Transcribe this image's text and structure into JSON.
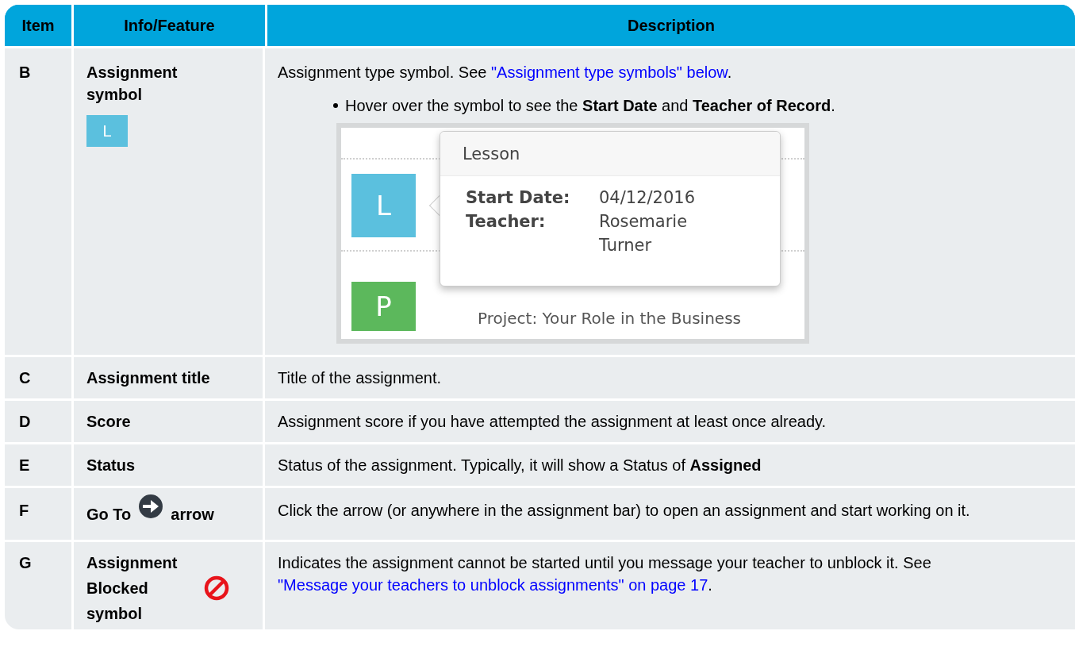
{
  "table": {
    "columns": [
      "Item",
      "Info/Feature",
      "Description"
    ],
    "rows": [
      {
        "item": "B",
        "feature": {
          "before": "Assignment symbol",
          "icon": {
            "kind": "tile",
            "letter": "L",
            "color": "#5bc0de"
          }
        },
        "description": [
          {
            "kind": "paragraph",
            "before": "Assignment type symbol. See ",
            "link": "\"Assignment type symbols\" below",
            "after": "."
          },
          {
            "kind": "bullet",
            "text": "Hover over the symbol to see the **Start Date** and **Teacher of Record**."
          },
          {
            "kind": "screenshot",
            "rows": [
              {
                "letter": "L",
                "color": "#5bc0de"
              },
              {
                "letter": "P",
                "color": "#5cb85c",
                "title": "Project: Your Role in the Business"
              }
            ],
            "tooltip": {
              "title": "Lesson",
              "fields": [
                {
                  "label": "Start Date:",
                  "value": "04/12/2016"
                },
                {
                  "label": "Teacher:",
                  "value": "Rosemarie Turner"
                }
              ]
            }
          }
        ]
      },
      {
        "item": "C",
        "feature": {
          "before": "Assignment title"
        },
        "description": [
          {
            "kind": "paragraph",
            "before": "Title of the assignment."
          }
        ]
      },
      {
        "item": "D",
        "feature": {
          "before": "Score"
        },
        "description": [
          {
            "kind": "paragraph",
            "before": "Assignment score if you have attempted the assignment at least once already."
          }
        ]
      },
      {
        "item": "E",
        "feature": {
          "before": "Status"
        },
        "description": [
          {
            "kind": "paragraph",
            "before": "Status of the assignment. Typically, it will show a Status of **Assigned**"
          }
        ]
      },
      {
        "item": "F",
        "feature": {
          "before": "Go To",
          "icon": {
            "kind": "goto"
          },
          "after": "arrow"
        },
        "description": [
          {
            "kind": "paragraph",
            "before": "Click the arrow (or anywhere in the assignment bar) to open an assignment and start working on it."
          }
        ]
      },
      {
        "item": "G",
        "feature": {
          "before": "Assignment Blocked",
          "icon": {
            "kind": "blocked"
          },
          "after": "symbol"
        },
        "description": [
          {
            "kind": "paragraph",
            "before": "Indicates the assignment cannot be started until you message your teacher to unblock it. See ",
            "link": "\"Message your teachers to unblock assignments\" on page 17",
            "after": "."
          }
        ]
      }
    ]
  }
}
